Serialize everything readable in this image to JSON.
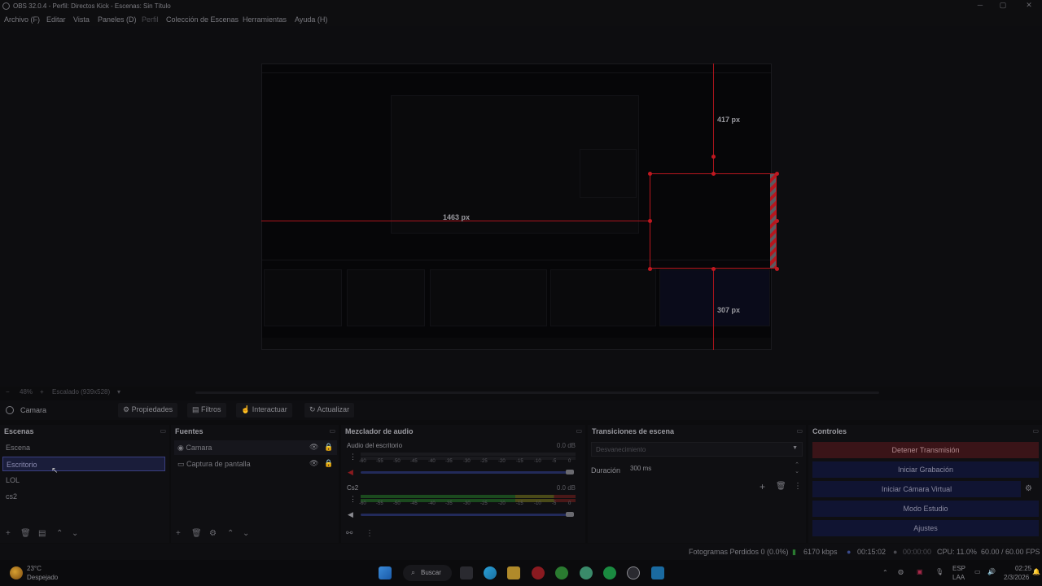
{
  "window": {
    "title": "OBS 32.0.4 - Perfil: Directos Kick - Escenas: Sin Título",
    "controls": [
      "minimize-icon",
      "maximize-icon",
      "close-icon"
    ]
  },
  "menu": {
    "file": "Archivo (F)",
    "edit": "Editar",
    "view": "Vista",
    "docks": "Paneles (D)",
    "profile": "Perfil",
    "scene_collection": "Colección de Escenas",
    "tools": "Herramientas",
    "help": "Ayuda (H)"
  },
  "preview": {
    "measure_top": "417 px",
    "measure_left": "1463 px",
    "measure_bottom": "307 px",
    "zoom": "48%",
    "scale": "Escalado (939x528)",
    "accent_red": "#b8161e"
  },
  "source_bar": {
    "source_name": "Camara",
    "properties": "Propiedades",
    "filters": "Filtros",
    "interact": "Interactuar",
    "refresh": "Actualizar"
  },
  "scenes": {
    "title": "Escenas",
    "items": [
      "Escena",
      "Escritorio",
      "LOL",
      "cs2"
    ],
    "selected": "Escritorio"
  },
  "sources": {
    "title": "Fuentes",
    "items": [
      "Camara",
      "Captura de pantalla"
    ]
  },
  "mixer": {
    "title": "Mezclador de audio",
    "tracks": [
      {
        "name": "Audio del escritorio",
        "db": "0.0 dB"
      },
      {
        "name": "Cs2",
        "db": "0.0 dB"
      }
    ],
    "ticks": [
      "-60",
      "-55",
      "-50",
      "-45",
      "-40",
      "-35",
      "-30",
      "-25",
      "-20",
      "-15",
      "-10",
      "-5",
      "0"
    ]
  },
  "transitions": {
    "title": "Transiciones de escena",
    "selected": "Desvanecimiento",
    "duration_label": "Duración",
    "duration_value": "300 ms"
  },
  "controls": {
    "title": "Controles",
    "stop_stream": "Detener Transmisión",
    "start_recording": "Iniciar Grabación",
    "start_virtual_cam": "Iniciar Cámara Virtual",
    "studio_mode": "Modo Estudio",
    "settings": "Ajustes"
  },
  "status": {
    "dropped": "Fotogramas Perdidos 0 (0.0%)",
    "bitrate": "6170 kbps",
    "stream_time": "00:15:02",
    "rec_time": "00:00:00",
    "cpu": "CPU: 11.0%",
    "fps": "60.00 / 60.00 FPS"
  },
  "taskbar": {
    "weather_temp": "23°C",
    "weather_desc": "Despejado",
    "search": "Buscar",
    "lang": "ESP",
    "lang_sub": "LAA",
    "time": "02:25",
    "date": "2/3/2026"
  }
}
